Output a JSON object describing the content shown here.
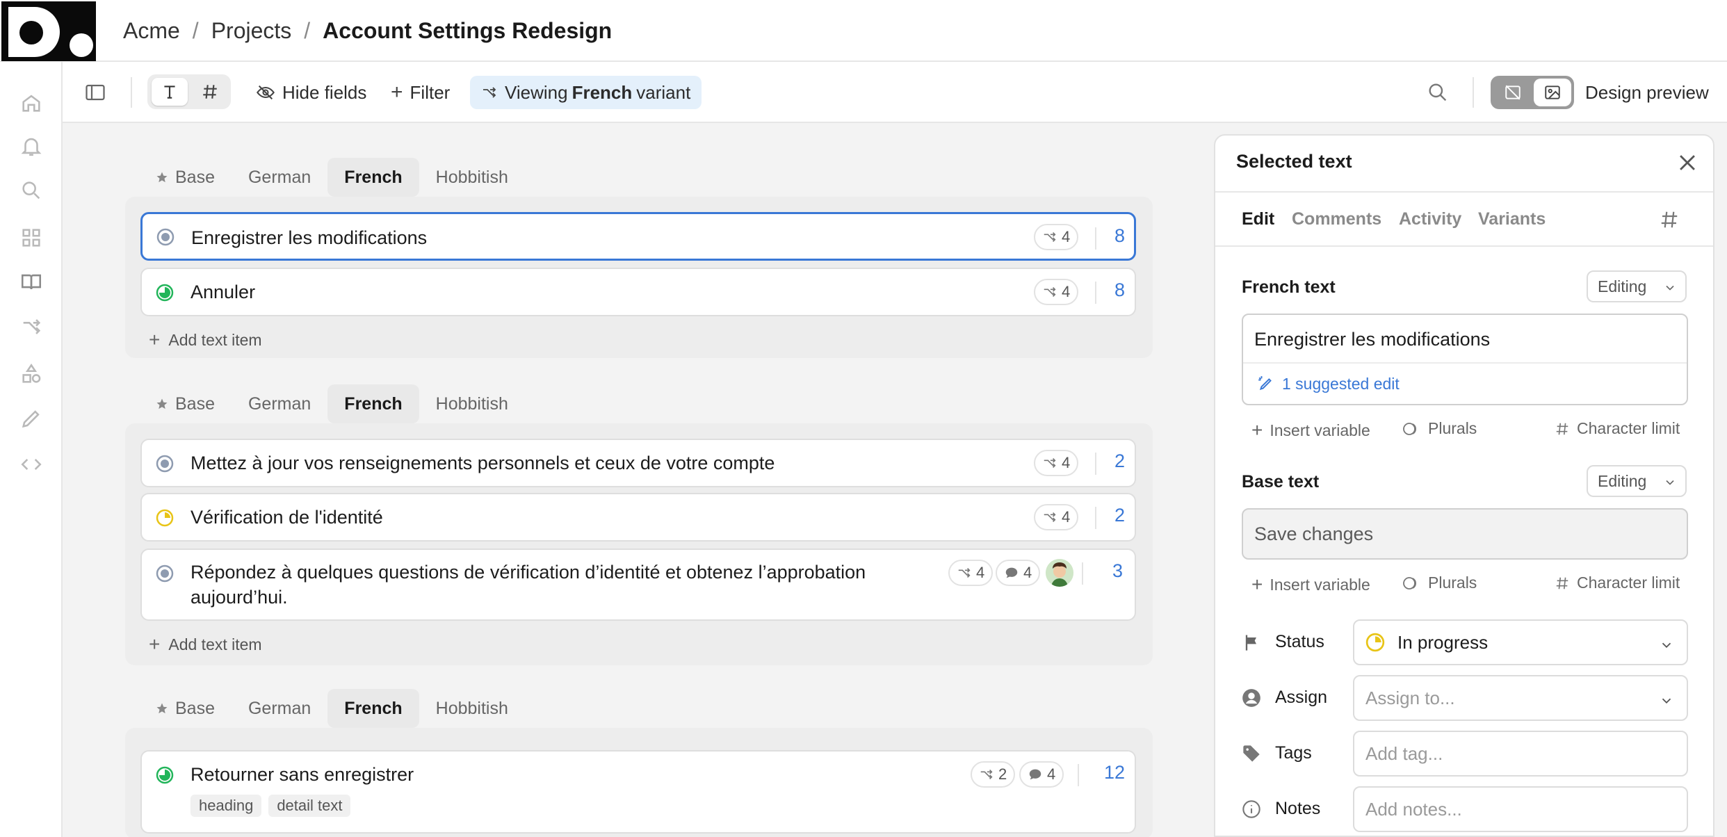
{
  "breadcrumb": {
    "org": "Acme",
    "section": "Projects",
    "current": "Account Settings Redesign",
    "separator": "/"
  },
  "toolbar": {
    "hide_fields": "Hide fields",
    "filter": "Filter",
    "viewing_prefix": "Viewing",
    "viewing_variant": "French",
    "viewing_suffix": "variant",
    "design_preview": "Design preview"
  },
  "variant_tabs": [
    "Base",
    "German",
    "French",
    "Hobbitish"
  ],
  "active_variant": "French",
  "add_text_item": "Add text item",
  "groups": [
    {
      "items": [
        {
          "text": "Enregistrer les modifications",
          "status": "none",
          "variants": "4",
          "count": "8",
          "selected": true
        },
        {
          "text": "Annuler",
          "status": "done",
          "variants": "4",
          "count": "8"
        }
      ]
    },
    {
      "items": [
        {
          "text": "Mettez à jour vos renseignements personnels et ceux de votre compte",
          "status": "none",
          "variants": "4",
          "count": "2"
        },
        {
          "text": "Vérification de l'identité",
          "status": "wip",
          "variants": "4",
          "count": "2"
        },
        {
          "text": "Répondez à quelques questions de vérification d’identité et obtenez l’approbation aujourd’hui.",
          "status": "none",
          "variants": "4",
          "comments": "4",
          "count": "3"
        }
      ]
    },
    {
      "items": [
        {
          "text": "Retourner sans enregistrer",
          "status": "done",
          "variants": "2",
          "comments": "4",
          "count": "12",
          "tags": [
            "heading",
            "detail text"
          ]
        }
      ]
    }
  ],
  "panel": {
    "title": "Selected text",
    "tabs": [
      "Edit",
      "Comments",
      "Activity",
      "Variants"
    ],
    "variant_label": "French text",
    "variant_mode": "Editing",
    "variant_value": "Enregistrer les modifications",
    "suggested_edit": "1 suggested edit",
    "tools": {
      "insert_variable": "Insert variable",
      "plurals": "Plurals",
      "character_limit": "Character limit"
    },
    "base_label": "Base text",
    "base_mode": "Editing",
    "base_value": "Save changes",
    "fields": {
      "status_label": "Status",
      "status_value": "In progress",
      "assign_label": "Assign",
      "assign_placeholder": "Assign to...",
      "tags_label": "Tags",
      "tags_placeholder": "Add tag...",
      "notes_label": "Notes",
      "notes_placeholder": "Add notes..."
    }
  },
  "colors": {
    "accent": "#3a78d6",
    "done": "#22b55a",
    "in_progress": "#e8c417",
    "none": "#8e9bb0"
  }
}
